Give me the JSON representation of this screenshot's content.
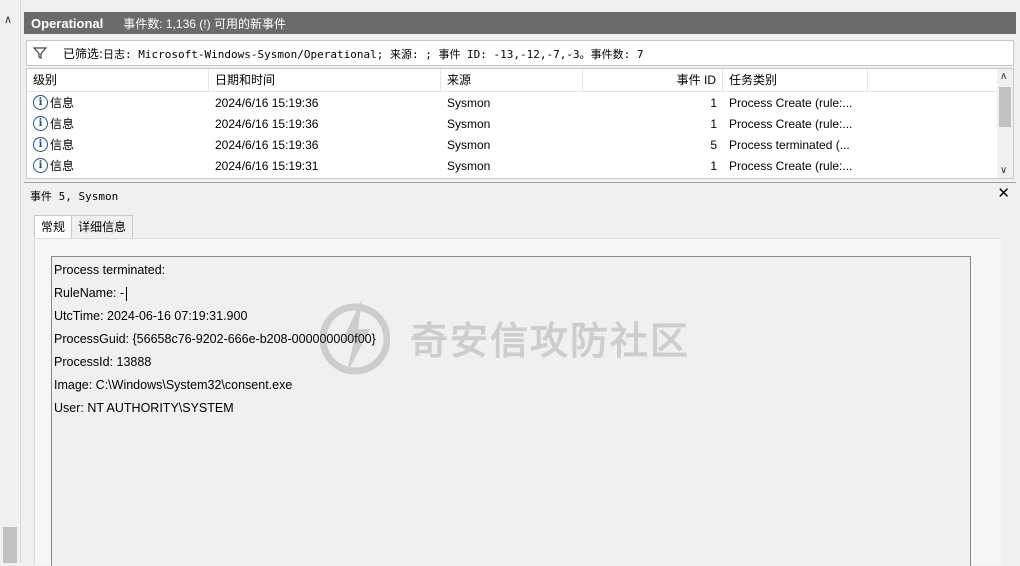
{
  "header": {
    "title": "Operational",
    "event_count": "事件数: 1,136 (!) 可用的新事件"
  },
  "filter": {
    "prefix": "已筛选:",
    "text": "日志: Microsoft-Windows-Sysmon/Operational; 来源: ; 事件 ID: -13,-12,-7,-3。事件数: 7"
  },
  "table": {
    "columns": [
      "级别",
      "日期和时间",
      "来源",
      "事件 ID",
      "任务类别"
    ],
    "rows": [
      {
        "level": "信息",
        "datetime": "2024/6/16 15:19:36",
        "source": "Sysmon",
        "event_id": "1",
        "category": "Process Create (rule:..."
      },
      {
        "level": "信息",
        "datetime": "2024/6/16 15:19:36",
        "source": "Sysmon",
        "event_id": "1",
        "category": "Process Create (rule:..."
      },
      {
        "level": "信息",
        "datetime": "2024/6/16 15:19:36",
        "source": "Sysmon",
        "event_id": "5",
        "category": "Process terminated (..."
      },
      {
        "level": "信息",
        "datetime": "2024/6/16 15:19:31",
        "source": "Sysmon",
        "event_id": "1",
        "category": "Process Create (rule:..."
      }
    ]
  },
  "detail": {
    "title": "事件 5, Sysmon",
    "tabs": [
      "常规",
      "详细信息"
    ],
    "lines": [
      "Process terminated:",
      "RuleName: -",
      "UtcTime: 2024-06-16 07:19:31.900",
      "ProcessGuid: {56658c76-9202-666e-b208-000000000f00}",
      "ProcessId: 13888",
      "Image: C:\\Windows\\System32\\consent.exe",
      "User: NT AUTHORITY\\SYSTEM"
    ],
    "watermark": "奇安信攻防社区"
  },
  "icons": {
    "filter": "filter-icon",
    "info": "info-icon",
    "close": "close-icon"
  }
}
